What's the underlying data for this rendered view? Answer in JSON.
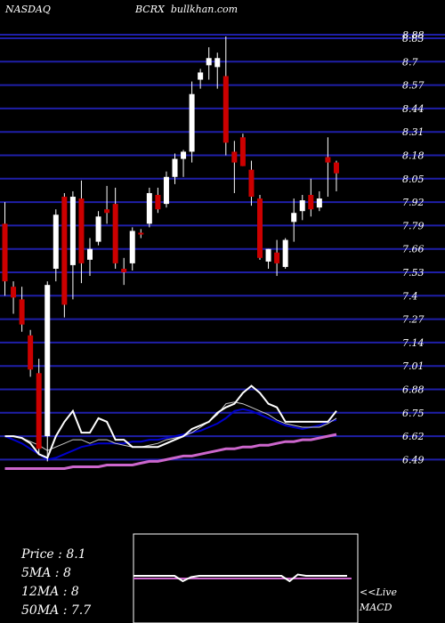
{
  "header": {
    "exchange": "NASDAQ",
    "symbol": "BCRX",
    "site": "bullkhan.com"
  },
  "info": {
    "price": "Price   : 8.1",
    "ma5": "5MA : 8",
    "ma12": "12MA : 8",
    "ma50": "50MA : 7.7"
  },
  "macd": {
    "live": "<<Live",
    "label": "MACD"
  },
  "colors": {
    "up": "#ffffff",
    "down": "#cc0000",
    "grid": "#1f1fa8",
    "ma_blue": "#0000cc",
    "ma_pink": "#cc66cc"
  },
  "chart_data": {
    "type": "candlestick",
    "title": "BCRX",
    "price_axis_ticks": [
      "8.83",
      "8.7",
      "8.57",
      "8.44",
      "8.31",
      "8.18",
      "8.05",
      "7.92",
      "7.79",
      "7.66",
      "7.53",
      "7.4",
      "7.27",
      "7.14",
      "7.01",
      "6.88",
      "6.75",
      "6.62",
      "6.49"
    ],
    "top_label": "8.88",
    "ylim": [
      6.45,
      8.88
    ],
    "candles": [
      {
        "o": 7.8,
        "h": 7.92,
        "l": 7.4,
        "c": 7.48
      },
      {
        "o": 7.45,
        "h": 7.48,
        "l": 7.3,
        "c": 7.39
      },
      {
        "o": 7.38,
        "h": 7.45,
        "l": 7.2,
        "c": 7.24
      },
      {
        "o": 7.18,
        "h": 7.21,
        "l": 6.95,
        "c": 6.99
      },
      {
        "o": 6.97,
        "h": 7.05,
        "l": 6.52,
        "c": 6.55
      },
      {
        "o": 6.62,
        "h": 7.48,
        "l": 6.48,
        "c": 7.46
      },
      {
        "o": 7.55,
        "h": 7.88,
        "l": 7.48,
        "c": 7.85
      },
      {
        "o": 7.95,
        "h": 7.97,
        "l": 7.28,
        "c": 7.35
      },
      {
        "o": 7.57,
        "h": 7.98,
        "l": 7.38,
        "c": 7.95
      },
      {
        "o": 7.94,
        "h": 8.04,
        "l": 7.47,
        "c": 7.58
      },
      {
        "o": 7.6,
        "h": 7.72,
        "l": 7.51,
        "c": 7.66
      },
      {
        "o": 7.7,
        "h": 7.87,
        "l": 7.68,
        "c": 7.84
      },
      {
        "o": 7.88,
        "h": 8.01,
        "l": 7.8,
        "c": 7.86
      },
      {
        "o": 7.91,
        "h": 8.0,
        "l": 7.55,
        "c": 7.58
      },
      {
        "o": 7.55,
        "h": 7.61,
        "l": 7.46,
        "c": 7.53
      },
      {
        "o": 7.58,
        "h": 7.78,
        "l": 7.54,
        "c": 7.76
      },
      {
        "o": 7.75,
        "h": 7.77,
        "l": 7.72,
        "c": 7.74
      },
      {
        "o": 7.8,
        "h": 8.0,
        "l": 7.78,
        "c": 7.97
      },
      {
        "o": 7.96,
        "h": 8.0,
        "l": 7.86,
        "c": 7.88
      },
      {
        "o": 7.91,
        "h": 8.09,
        "l": 7.89,
        "c": 8.06
      },
      {
        "o": 8.06,
        "h": 8.19,
        "l": 8.02,
        "c": 8.16
      },
      {
        "o": 8.16,
        "h": 8.21,
        "l": 8.06,
        "c": 8.2
      },
      {
        "o": 8.2,
        "h": 8.59,
        "l": 8.14,
        "c": 8.52
      },
      {
        "o": 8.6,
        "h": 8.66,
        "l": 8.55,
        "c": 8.64
      },
      {
        "o": 8.68,
        "h": 8.78,
        "l": 8.6,
        "c": 8.72
      },
      {
        "o": 8.67,
        "h": 8.75,
        "l": 8.55,
        "c": 8.72
      },
      {
        "o": 8.62,
        "h": 8.84,
        "l": 8.18,
        "c": 8.25
      },
      {
        "o": 8.2,
        "h": 8.26,
        "l": 7.97,
        "c": 8.14
      },
      {
        "o": 8.28,
        "h": 8.3,
        "l": 8.12,
        "c": 8.12
      },
      {
        "o": 8.1,
        "h": 8.15,
        "l": 7.9,
        "c": 7.95
      },
      {
        "o": 7.94,
        "h": 7.96,
        "l": 7.6,
        "c": 7.61
      },
      {
        "o": 7.59,
        "h": 7.66,
        "l": 7.55,
        "c": 7.66
      },
      {
        "o": 7.64,
        "h": 7.71,
        "l": 7.51,
        "c": 7.58
      },
      {
        "o": 7.56,
        "h": 7.72,
        "l": 7.55,
        "c": 7.71
      },
      {
        "o": 7.81,
        "h": 7.94,
        "l": 7.7,
        "c": 7.86
      },
      {
        "o": 7.87,
        "h": 7.96,
        "l": 7.82,
        "c": 7.93
      },
      {
        "o": 7.96,
        "h": 8.05,
        "l": 7.84,
        "c": 7.88
      },
      {
        "o": 7.89,
        "h": 7.98,
        "l": 7.87,
        "c": 7.94
      },
      {
        "o": 8.17,
        "h": 8.28,
        "l": 7.95,
        "c": 8.14
      },
      {
        "o": 8.14,
        "h": 8.15,
        "l": 7.98,
        "c": 8.08
      }
    ],
    "ma_white": [
      6.62,
      6.62,
      6.61,
      6.58,
      6.52,
      6.5,
      6.62,
      6.7,
      6.76,
      6.64,
      6.64,
      6.72,
      6.7,
      6.6,
      6.6,
      6.56,
      6.56,
      6.56,
      6.56,
      6.58,
      6.6,
      6.62,
      6.66,
      6.68,
      6.7,
      6.75,
      6.78,
      6.8,
      6.86,
      6.9,
      6.86,
      6.8,
      6.78,
      6.7,
      6.7,
      6.7,
      6.7,
      6.7,
      6.7,
      6.76
    ],
    "ma_grey": [
      6.62,
      6.62,
      6.61,
      6.59,
      6.57,
      6.54,
      6.56,
      6.58,
      6.6,
      6.6,
      6.58,
      6.6,
      6.6,
      6.58,
      6.57,
      6.56,
      6.56,
      6.57,
      6.58,
      6.6,
      6.61,
      6.62,
      6.64,
      6.67,
      6.7,
      6.74,
      6.8,
      6.81,
      6.8,
      6.78,
      6.76,
      6.74,
      6.71,
      6.69,
      6.68,
      6.67,
      6.67,
      6.67,
      6.69,
      6.72
    ],
    "ma_blue": [
      6.62,
      6.6,
      6.58,
      6.55,
      6.52,
      6.49,
      6.5,
      6.52,
      6.54,
      6.56,
      6.57,
      6.58,
      6.58,
      6.58,
      6.58,
      6.59,
      6.59,
      6.6,
      6.6,
      6.61,
      6.62,
      6.63,
      6.64,
      6.65,
      6.67,
      6.69,
      6.72,
      6.76,
      6.77,
      6.76,
      6.74,
      6.72,
      6.7,
      6.68,
      6.67,
      6.66,
      6.67,
      6.68,
      6.7,
      6.71
    ],
    "ma_pink": [
      6.44,
      6.44,
      6.44,
      6.44,
      6.44,
      6.44,
      6.44,
      6.44,
      6.45,
      6.45,
      6.45,
      6.45,
      6.46,
      6.46,
      6.46,
      6.46,
      6.47,
      6.48,
      6.48,
      6.49,
      6.5,
      6.51,
      6.51,
      6.52,
      6.53,
      6.54,
      6.55,
      6.55,
      6.56,
      6.56,
      6.57,
      6.57,
      6.58,
      6.59,
      6.59,
      6.6,
      6.6,
      6.61,
      6.62,
      6.63
    ],
    "macd_signal": [
      0.02,
      0.02,
      0.02,
      0.02,
      0.02,
      0.02,
      -0.02,
      0.01,
      0.02,
      0.02,
      0.02,
      0.02,
      0.02,
      0.02,
      0.02,
      0.02,
      0.02,
      0.02,
      0.02,
      -0.02,
      0.03,
      0.02,
      0.02,
      0.02,
      0.02,
      0.02,
      0.02
    ]
  }
}
